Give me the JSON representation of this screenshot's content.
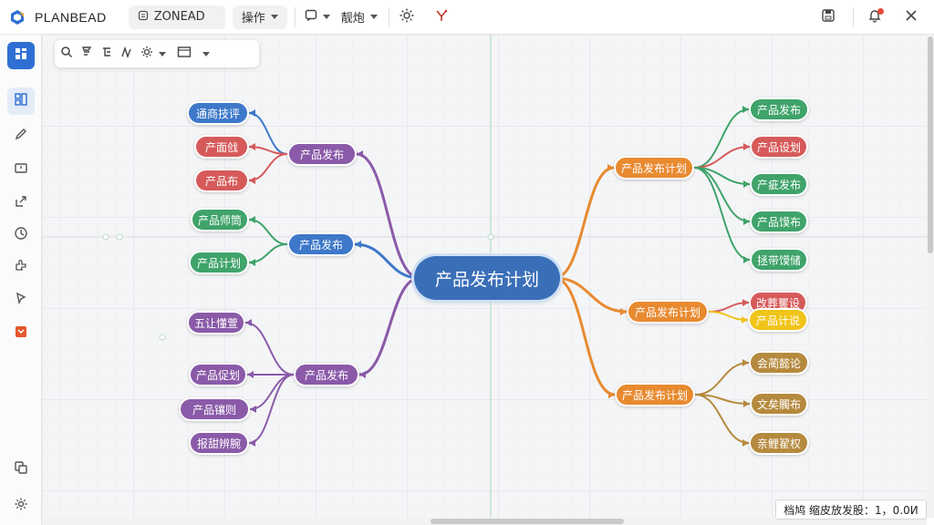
{
  "app": {
    "name": "PLANBEAD",
    "zone_button": "ZONEAD",
    "operate_menu": "操作",
    "view_menu": "靓炮"
  },
  "colors": {
    "root": "#3a6fb8",
    "blue": "#3d78c9",
    "purple": "#8a5aa8",
    "red": "#d65a5a",
    "green": "#3fa36a",
    "orange": "#e88a30",
    "yellow": "#f0c419",
    "gold": "#b58a3e"
  },
  "mindmap": {
    "root": "产品发布计划",
    "left": [
      {
        "label": "产品发布",
        "color": "purple",
        "children": [
          {
            "label": "通商技评",
            "color": "blue"
          },
          {
            "label": "产面戗",
            "color": "red"
          },
          {
            "label": "产品布",
            "color": "red"
          }
        ]
      },
      {
        "label": "产品发布",
        "color": "blue",
        "children": [
          {
            "label": "产品师筒",
            "color": "green"
          },
          {
            "label": "产品计划",
            "color": "green"
          }
        ]
      },
      {
        "label": "产品发布",
        "color": "purple",
        "children": [
          {
            "label": "五让懂萱",
            "color": "purple"
          },
          {
            "label": "产品促划",
            "color": "purple"
          },
          {
            "label": "产品镶则",
            "color": "purple"
          },
          {
            "label": "报甜辨腕",
            "color": "purple"
          }
        ]
      }
    ],
    "right": [
      {
        "label": "产品发布计划",
        "color": "orange",
        "children": [
          {
            "label": "产品发布",
            "color": "green"
          },
          {
            "label": "产品设划",
            "color": "red"
          },
          {
            "label": "产疵发布",
            "color": "green"
          },
          {
            "label": "产品馍布",
            "color": "green"
          },
          {
            "label": "拯带馍储",
            "color": "green"
          }
        ]
      },
      {
        "label": "产品发布计划",
        "color": "orange",
        "children": [
          {
            "label": "改葬矍设",
            "color": "red"
          },
          {
            "label": "产品计说",
            "color": "yellow"
          }
        ]
      },
      {
        "label": "产品发布计划",
        "color": "orange",
        "children": [
          {
            "label": "会蔺懿论",
            "color": "gold"
          },
          {
            "label": "文矣髑布",
            "color": "gold"
          },
          {
            "label": "亲鲤翟权",
            "color": "gold"
          }
        ]
      }
    ]
  },
  "status": {
    "text": "档鸠 缩皮放发股：1，0.0И"
  },
  "icons": {
    "topbar": [
      "save-icon",
      "notification-bell-icon",
      "close-icon",
      "settings-gear-icon",
      "share-icon"
    ],
    "leftrail": [
      "grid-icon",
      "layout-icon",
      "pen-icon",
      "box-icon",
      "export-icon",
      "history-icon",
      "puzzle-icon",
      "marker-icon",
      "plugin-icon",
      "copy-icon",
      "settings-icon"
    ]
  }
}
